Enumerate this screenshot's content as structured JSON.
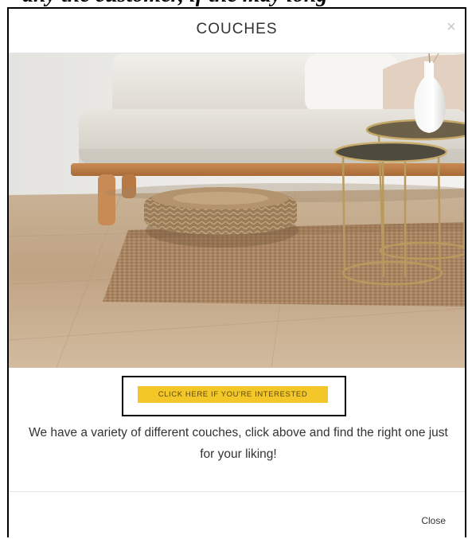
{
  "caption": {
    "text": "any the customer, if the may long"
  },
  "modal": {
    "title": "COUCHES",
    "close_icon": "close-x-icon",
    "hero_image": "couch-living-room-photo",
    "cta_label": "CLICK HERE IF YOU'RE INTERESTED",
    "description": "We have a variety of different couches, click above and find the right one just for your liking!",
    "footer_close_label": "Close"
  },
  "colors": {
    "cta_background": "#f4c729",
    "frame_border": "#000000",
    "title_text": "#333333"
  }
}
